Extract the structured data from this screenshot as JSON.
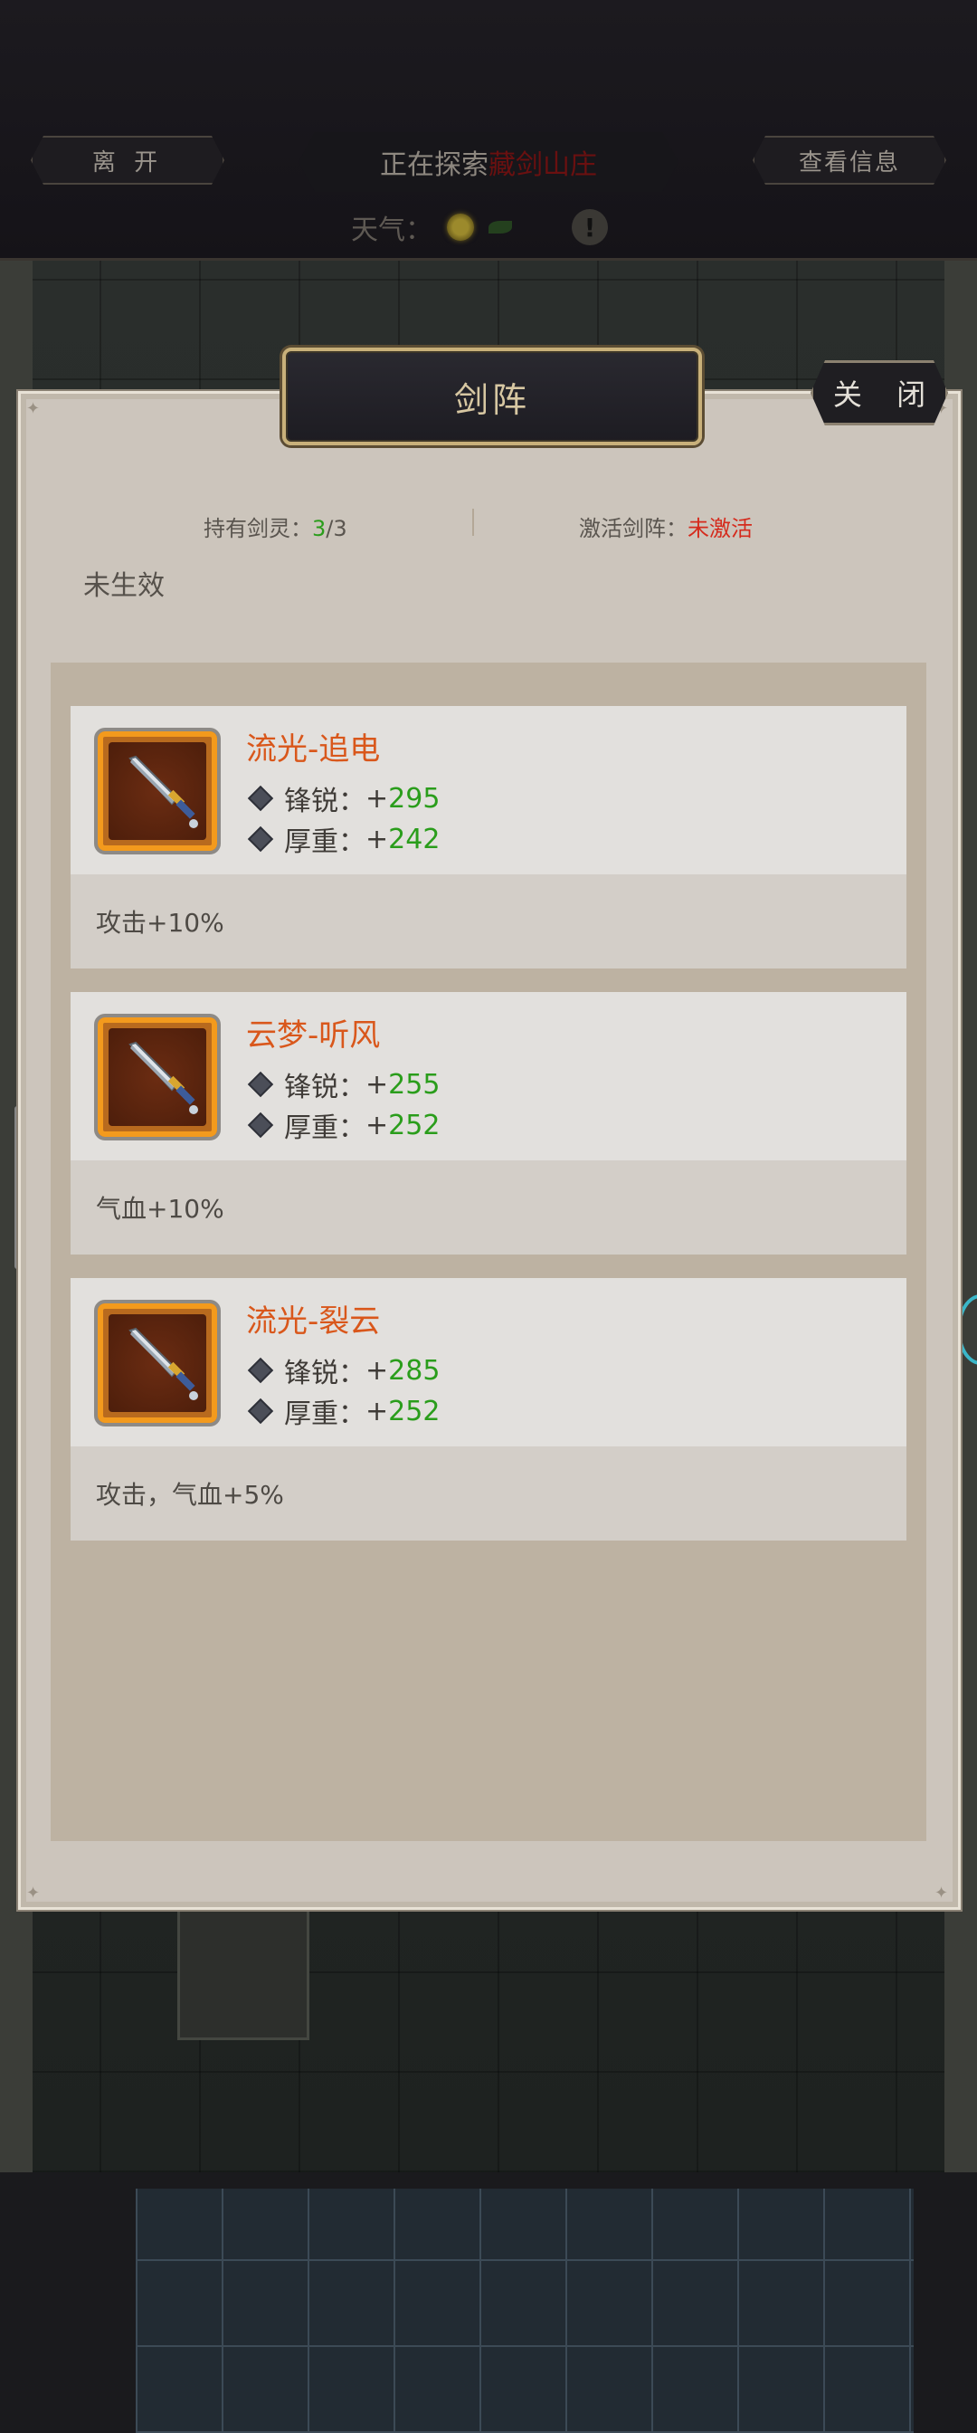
{
  "topbar": {
    "leave_label": "离 开",
    "exploring_prefix": "正在探索",
    "exploring_place": "藏剑山庄",
    "info_label": "查看信息",
    "weather_label": "天气："
  },
  "dialog": {
    "title": "剑阵",
    "close_label": "关 闭",
    "held_label": "持有剑灵：",
    "held_count": "3",
    "held_total": "/3",
    "active_label": "激活剑阵：",
    "active_value": "未激活",
    "effect_text": "未生效"
  },
  "cards": [
    {
      "name": "流光-追电",
      "stat1_label": "锋锐：",
      "stat1_sign": "+",
      "stat1_value": "295",
      "stat2_label": "厚重：",
      "stat2_sign": "+",
      "stat2_value": "242",
      "bonus": "攻击+10%"
    },
    {
      "name": "云梦-听风",
      "stat1_label": "锋锐：",
      "stat1_sign": "+",
      "stat1_value": "255",
      "stat2_label": "厚重：",
      "stat2_sign": "+",
      "stat2_value": "252",
      "bonus": "气血+10%"
    },
    {
      "name": "流光-裂云",
      "stat1_label": "锋锐：",
      "stat1_sign": "+",
      "stat1_value": "285",
      "stat2_label": "厚重：",
      "stat2_sign": "+",
      "stat2_value": "252",
      "bonus": "攻击，气血+5%"
    }
  ],
  "colors": {
    "name_orange": "#d9571b",
    "value_green": "#2a9d1b",
    "inactive_red": "#d52a1c",
    "title_gold": "#d7c7a2"
  }
}
